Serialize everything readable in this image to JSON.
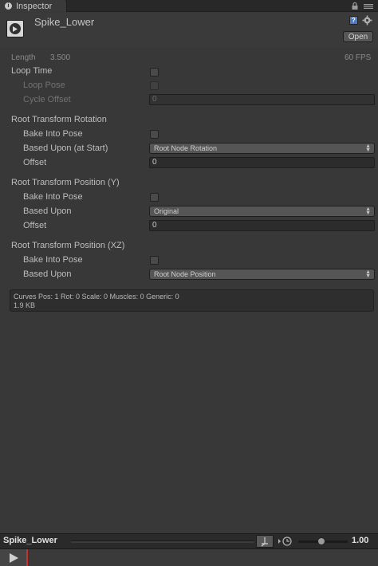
{
  "tab": {
    "title": "Inspector"
  },
  "header": {
    "asset_name": "Spike_Lower",
    "open_label": "Open"
  },
  "info": {
    "length_label": "Length",
    "length_value": "3.500",
    "fps": "60 FPS"
  },
  "loop": {
    "loop_time_label": "Loop Time",
    "loop_pose_label": "Loop Pose",
    "cycle_offset_label": "Cycle Offset",
    "cycle_offset_value": "0"
  },
  "root_rotation": {
    "heading": "Root Transform Rotation",
    "bake_label": "Bake Into Pose",
    "based_label": "Based Upon (at Start)",
    "based_value": "Root Node Rotation",
    "offset_label": "Offset",
    "offset_value": "0"
  },
  "root_position_y": {
    "heading": "Root Transform Position (Y)",
    "bake_label": "Bake Into Pose",
    "based_label": "Based Upon",
    "based_value": "Original",
    "offset_label": "Offset",
    "offset_value": "0"
  },
  "root_position_xz": {
    "heading": "Root Transform Position (XZ)",
    "bake_label": "Bake Into Pose",
    "based_label": "Based Upon",
    "based_value": "Root Node Position"
  },
  "curves": {
    "line1": "Curves Pos: 1 Rot: 0 Scale: 0 Muscles: 0 Generic: 0",
    "line2": "1.9 KB"
  },
  "preview": {
    "title": "Spike_Lower",
    "speed": "1.00"
  }
}
